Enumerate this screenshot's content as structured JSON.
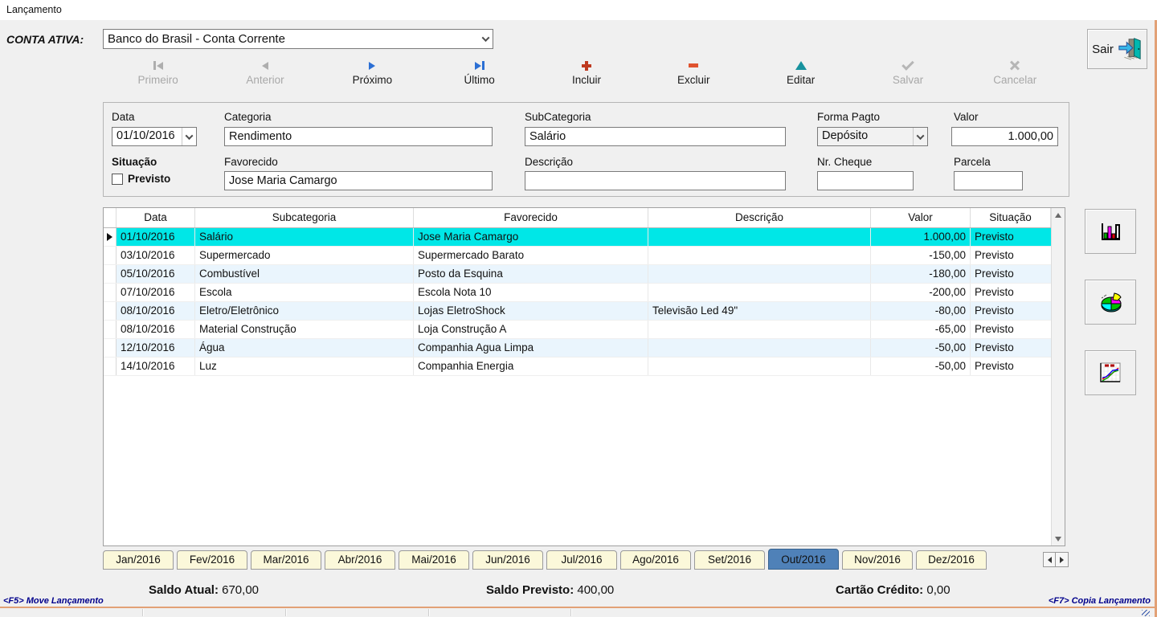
{
  "colors": {
    "selected_row": "#00e7e7",
    "alt_row": "#eaf5fd",
    "active_tab": "#4f81b8",
    "tab_cream": "#fbf8da",
    "window_border": "#e2a176",
    "note_navy": "#00008b",
    "arrow_blue": "#2b6fd4",
    "add_red": "#bf3a20",
    "del_orange": "#e0532f",
    "edit_teal": "#17929e"
  },
  "window": {
    "title": "Lançamento"
  },
  "account_bar": {
    "label": "CONTA ATIVA:",
    "value": "Banco do Brasil - Conta Corrente",
    "exit_label": "Sair"
  },
  "toolbar": {
    "buttons": [
      {
        "id": "first",
        "label": "Primeiro",
        "icon": "first-record-icon",
        "enabled": false
      },
      {
        "id": "prev",
        "label": "Anterior",
        "icon": "previous-record-icon",
        "enabled": false
      },
      {
        "id": "next",
        "label": "Próximo",
        "icon": "next-record-icon",
        "enabled": true
      },
      {
        "id": "last",
        "label": "Último",
        "icon": "last-record-icon",
        "enabled": true
      },
      {
        "id": "add",
        "label": "Incluir",
        "icon": "add-icon",
        "enabled": true
      },
      {
        "id": "del",
        "label": "Excluir",
        "icon": "remove-icon",
        "enabled": true
      },
      {
        "id": "edit",
        "label": "Editar",
        "icon": "edit-icon",
        "enabled": true
      },
      {
        "id": "save",
        "label": "Salvar",
        "icon": "save-check-icon",
        "enabled": false
      },
      {
        "id": "cancel",
        "label": "Cancelar",
        "icon": "cancel-x-icon",
        "enabled": false
      }
    ]
  },
  "form": {
    "data_label": "Data",
    "data_value": "01/10/2016",
    "categoria_label": "Categoria",
    "categoria_value": "Rendimento",
    "subcategoria_label": "SubCategoria",
    "subcategoria_value": "Salário",
    "forma_pagto_label": "Forma Pagto",
    "forma_pagto_value": "Depósito",
    "valor_label": "Valor",
    "valor_value": "1.000,00",
    "situacao_label": "Situação",
    "previsto_label": "Previsto",
    "previsto_checked": false,
    "favorecido_label": "Favorecido",
    "favorecido_value": "Jose Maria Camargo",
    "descricao_label": "Descrição",
    "descricao_value": "",
    "nr_cheque_label": "Nr. Cheque",
    "nr_cheque_value": "",
    "parcela_label": "Parcela",
    "parcela_value": ""
  },
  "grid": {
    "columns": [
      "Data",
      "Subcategoria",
      "Favorecido",
      "Descrição",
      "Valor",
      "Situação"
    ],
    "rows": [
      {
        "data": "01/10/2016",
        "subcategoria": "Salário",
        "favorecido": "Jose Maria Camargo",
        "descricao": "",
        "valor": "1.000,00",
        "situacao": "Previsto",
        "selected": true
      },
      {
        "data": "03/10/2016",
        "subcategoria": "Supermercado",
        "favorecido": "Supermercado Barato",
        "descricao": "",
        "valor": "-150,00",
        "situacao": "Previsto",
        "selected": false
      },
      {
        "data": "05/10/2016",
        "subcategoria": "Combustível",
        "favorecido": "Posto da Esquina",
        "descricao": "",
        "valor": "-180,00",
        "situacao": "Previsto",
        "selected": false
      },
      {
        "data": "07/10/2016",
        "subcategoria": "Escola",
        "favorecido": "Escola Nota 10",
        "descricao": "",
        "valor": "-200,00",
        "situacao": "Previsto",
        "selected": false
      },
      {
        "data": "08/10/2016",
        "subcategoria": "Eletro/Eletrônico",
        "favorecido": "Lojas EletroShock",
        "descricao": "Televisão Led 49\"",
        "valor": "-80,00",
        "situacao": "Previsto",
        "selected": false
      },
      {
        "data": "08/10/2016",
        "subcategoria": "Material Construção",
        "favorecido": "Loja Construção A",
        "descricao": "",
        "valor": "-65,00",
        "situacao": "Previsto",
        "selected": false
      },
      {
        "data": "12/10/2016",
        "subcategoria": "Água",
        "favorecido": "Companhia Agua Limpa",
        "descricao": "",
        "valor": "-50,00",
        "situacao": "Previsto",
        "selected": false
      },
      {
        "data": "14/10/2016",
        "subcategoria": "Luz",
        "favorecido": "Companhia Energia",
        "descricao": "",
        "valor": "-50,00",
        "situacao": "Previsto",
        "selected": false
      }
    ]
  },
  "tabs": {
    "items": [
      "Jan/2016",
      "Fev/2016",
      "Mar/2016",
      "Abr/2016",
      "Mai/2016",
      "Jun/2016",
      "Jul/2016",
      "Ago/2016",
      "Set/2016",
      "Out/2016",
      "Nov/2016",
      "Dez/2016"
    ],
    "selected": "Out/2016",
    "selected_index": 9
  },
  "footer": {
    "saldo_atual_label": "Saldo Atual:",
    "saldo_atual_value": "670,00",
    "saldo_previsto_label": "Saldo Previsto:",
    "saldo_previsto_value": "400,00",
    "cartao_credito_label": "Cartão Crédito:",
    "cartao_credito_value": "0,00",
    "f5_note": "<F5> Move Lançamento",
    "f7_note": "<F7> Copia Lançamento"
  }
}
